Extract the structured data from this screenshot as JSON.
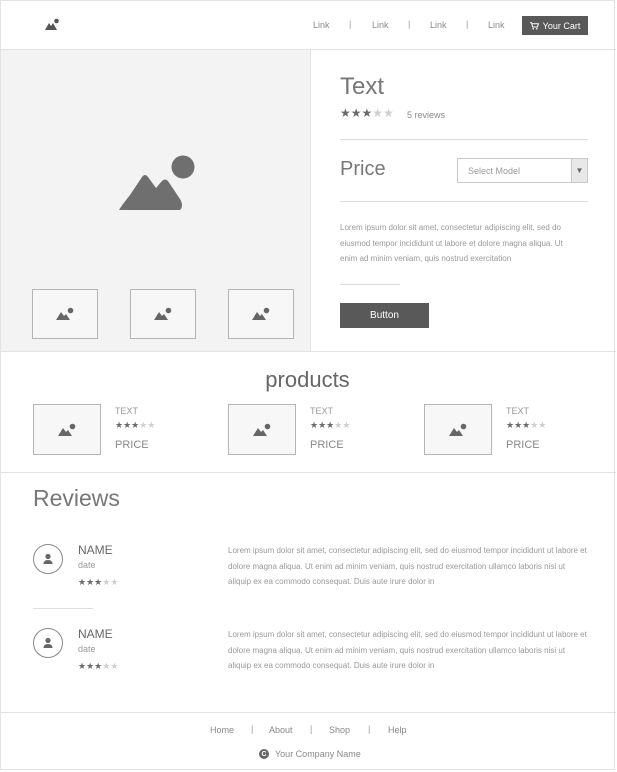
{
  "header": {
    "links": [
      "Link",
      "Link",
      "Link",
      "Link"
    ],
    "separator": "|",
    "cart_label": "Your Cart"
  },
  "product": {
    "title": "Text",
    "rating": 3,
    "rating_max": 5,
    "reviews_label": "5 reviews",
    "price_label": "Price",
    "model_select": "Select Model",
    "description": "Lorem ipsum dolor sit amet, consectetur adipiscing elit, sed do eiusmod tempor incididunt ut labore et dolore magna aliqua. Ut enim ad minim veniam, quis nostrud exercitation",
    "button_label": "Button"
  },
  "products_section": {
    "title": "products",
    "items": [
      {
        "text": "TEXT",
        "rating": 3,
        "price": "PRICE"
      },
      {
        "text": "TEXT",
        "rating": 3,
        "price": "PRICE"
      },
      {
        "text": "TEXT",
        "rating": 3,
        "price": "PRICE"
      }
    ]
  },
  "reviews_section": {
    "title": "Reviews",
    "items": [
      {
        "name": "NAME",
        "date": "date",
        "rating": 3,
        "text": "Lorem ipsum dolor sit amet, consectetur adipiscing elit, sed do eiusmod tempor incididunt ut labore et dolore magna aliqua. Ut enim ad minim veniam, quis nostrud exercitation ullamco laboris nisi ut aliquip ex ea commodo consequat. Duis aute irure dolor in"
      },
      {
        "name": "NAME",
        "date": "date",
        "rating": 3,
        "text": "Lorem ipsum dolor sit amet, consectetur adipiscing elit, sed do eiusmod tempor incididunt ut labore et dolore magna aliqua. Ut enim ad minim veniam, quis nostrud exercitation ullamco laboris nisi ut aliquip ex ea commodo consequat. Duis aute irure dolor in"
      }
    ]
  },
  "footer": {
    "links": [
      "Home",
      "About",
      "Shop",
      "Help"
    ],
    "separator": "|",
    "copyright_symbol": "C",
    "company": "Your Company Name"
  },
  "colors": {
    "accent": "#595959",
    "star_on": "#6a6a6a",
    "star_off": "#cfcfcf"
  }
}
